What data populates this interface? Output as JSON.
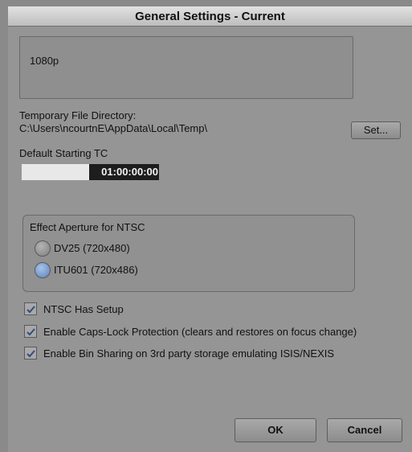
{
  "window": {
    "title": "General Settings - Current"
  },
  "info_box": {
    "text": "1080p"
  },
  "temp_dir": {
    "label": "Temporary File Directory:",
    "path": "C:\\Users\\ncourtnE\\AppData\\Local\\Temp\\",
    "set_button": "Set..."
  },
  "default_tc": {
    "label": "Default Starting TC",
    "value": "01:00:00:00"
  },
  "effect_aperture": {
    "title": "Effect Aperture for NTSC",
    "options": [
      {
        "label": "DV25 (720x480)",
        "selected": false
      },
      {
        "label": "ITU601 (720x486)",
        "selected": true
      }
    ]
  },
  "checkboxes": [
    {
      "label": "NTSC Has Setup",
      "checked": true
    },
    {
      "label": "Enable Caps-Lock Protection (clears and restores on focus change)",
      "checked": true
    },
    {
      "label": "Enable Bin Sharing on 3rd party storage emulating ISIS/NEXIS",
      "checked": true
    }
  ],
  "buttons": {
    "ok": "OK",
    "cancel": "Cancel"
  }
}
